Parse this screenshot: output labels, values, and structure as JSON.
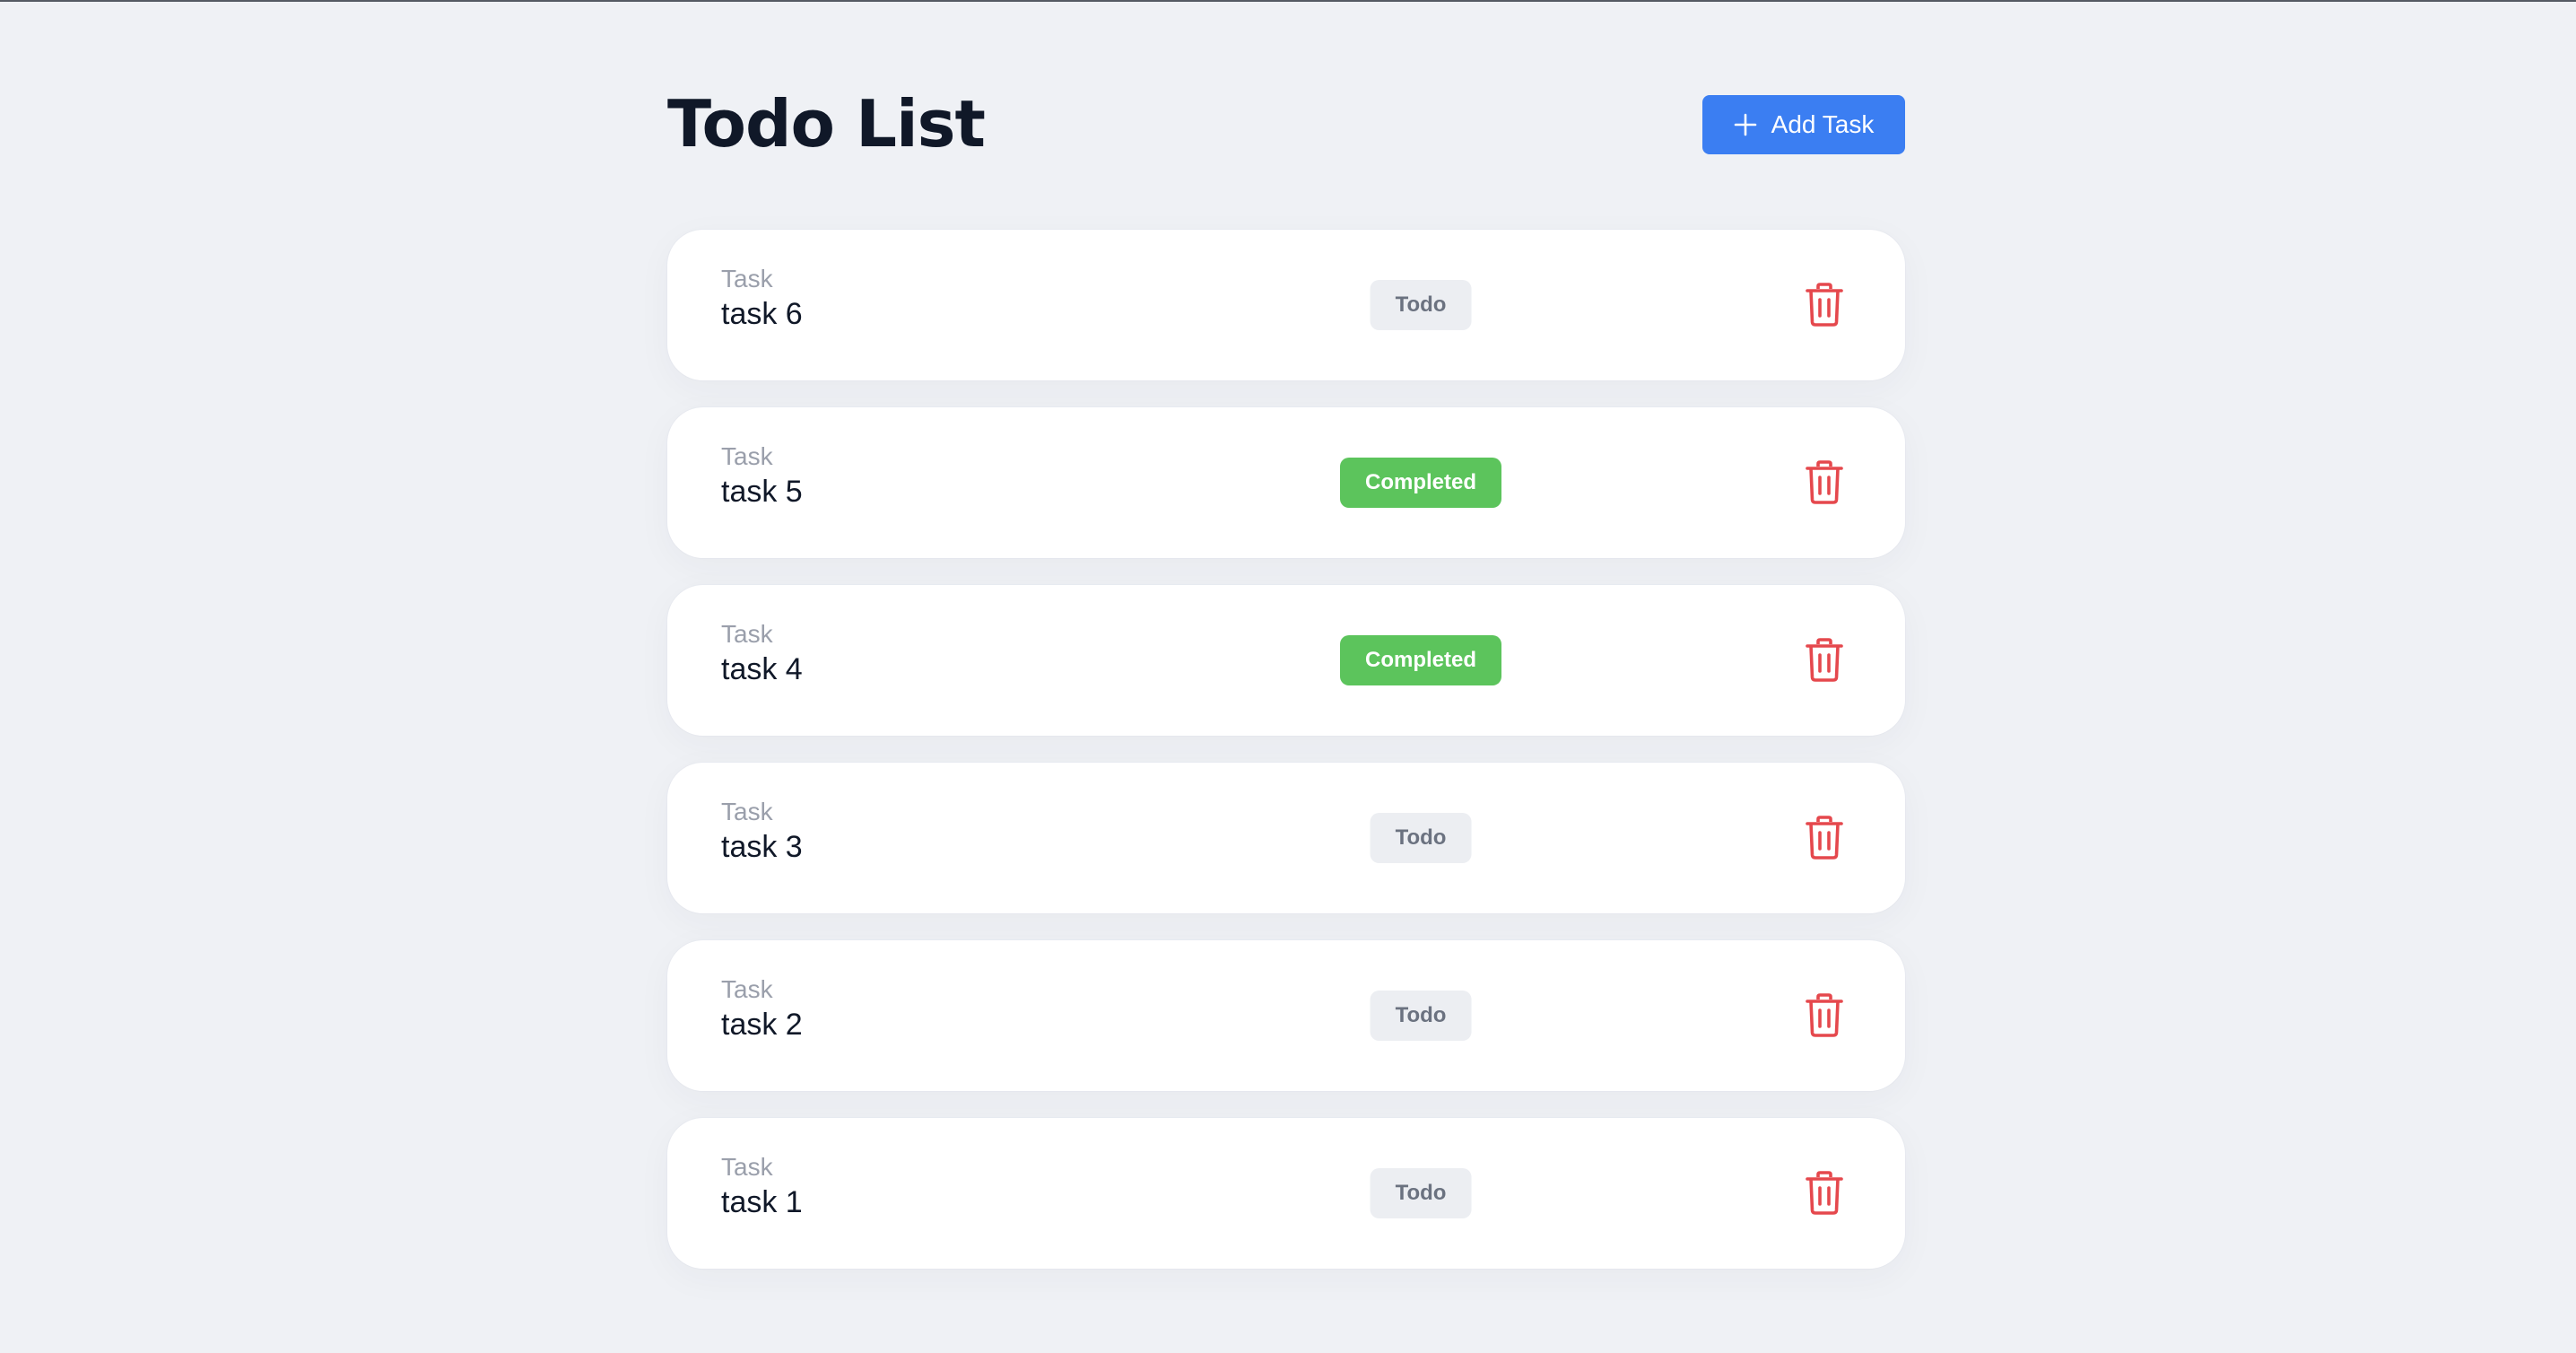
{
  "header": {
    "title": "Todo List",
    "add_button_label": "Add Task",
    "add_button_icon": "plus-icon"
  },
  "tasks": [
    {
      "caption": "Task",
      "name": "task 6",
      "status": "Todo"
    },
    {
      "caption": "Task",
      "name": "task 5",
      "status": "Completed"
    },
    {
      "caption": "Task",
      "name": "task 4",
      "status": "Completed"
    },
    {
      "caption": "Task",
      "name": "task 3",
      "status": "Todo"
    },
    {
      "caption": "Task",
      "name": "task 2",
      "status": "Todo"
    },
    {
      "caption": "Task",
      "name": "task 1",
      "status": "Todo"
    }
  ],
  "icons": {
    "delete": "trash-icon"
  },
  "colors": {
    "background": "#eff1f5",
    "accent": "#3b7ef2",
    "completed": "#5cc45c",
    "todo_badge": "#eceef2",
    "delete": "#e5484d",
    "title": "#101828"
  }
}
